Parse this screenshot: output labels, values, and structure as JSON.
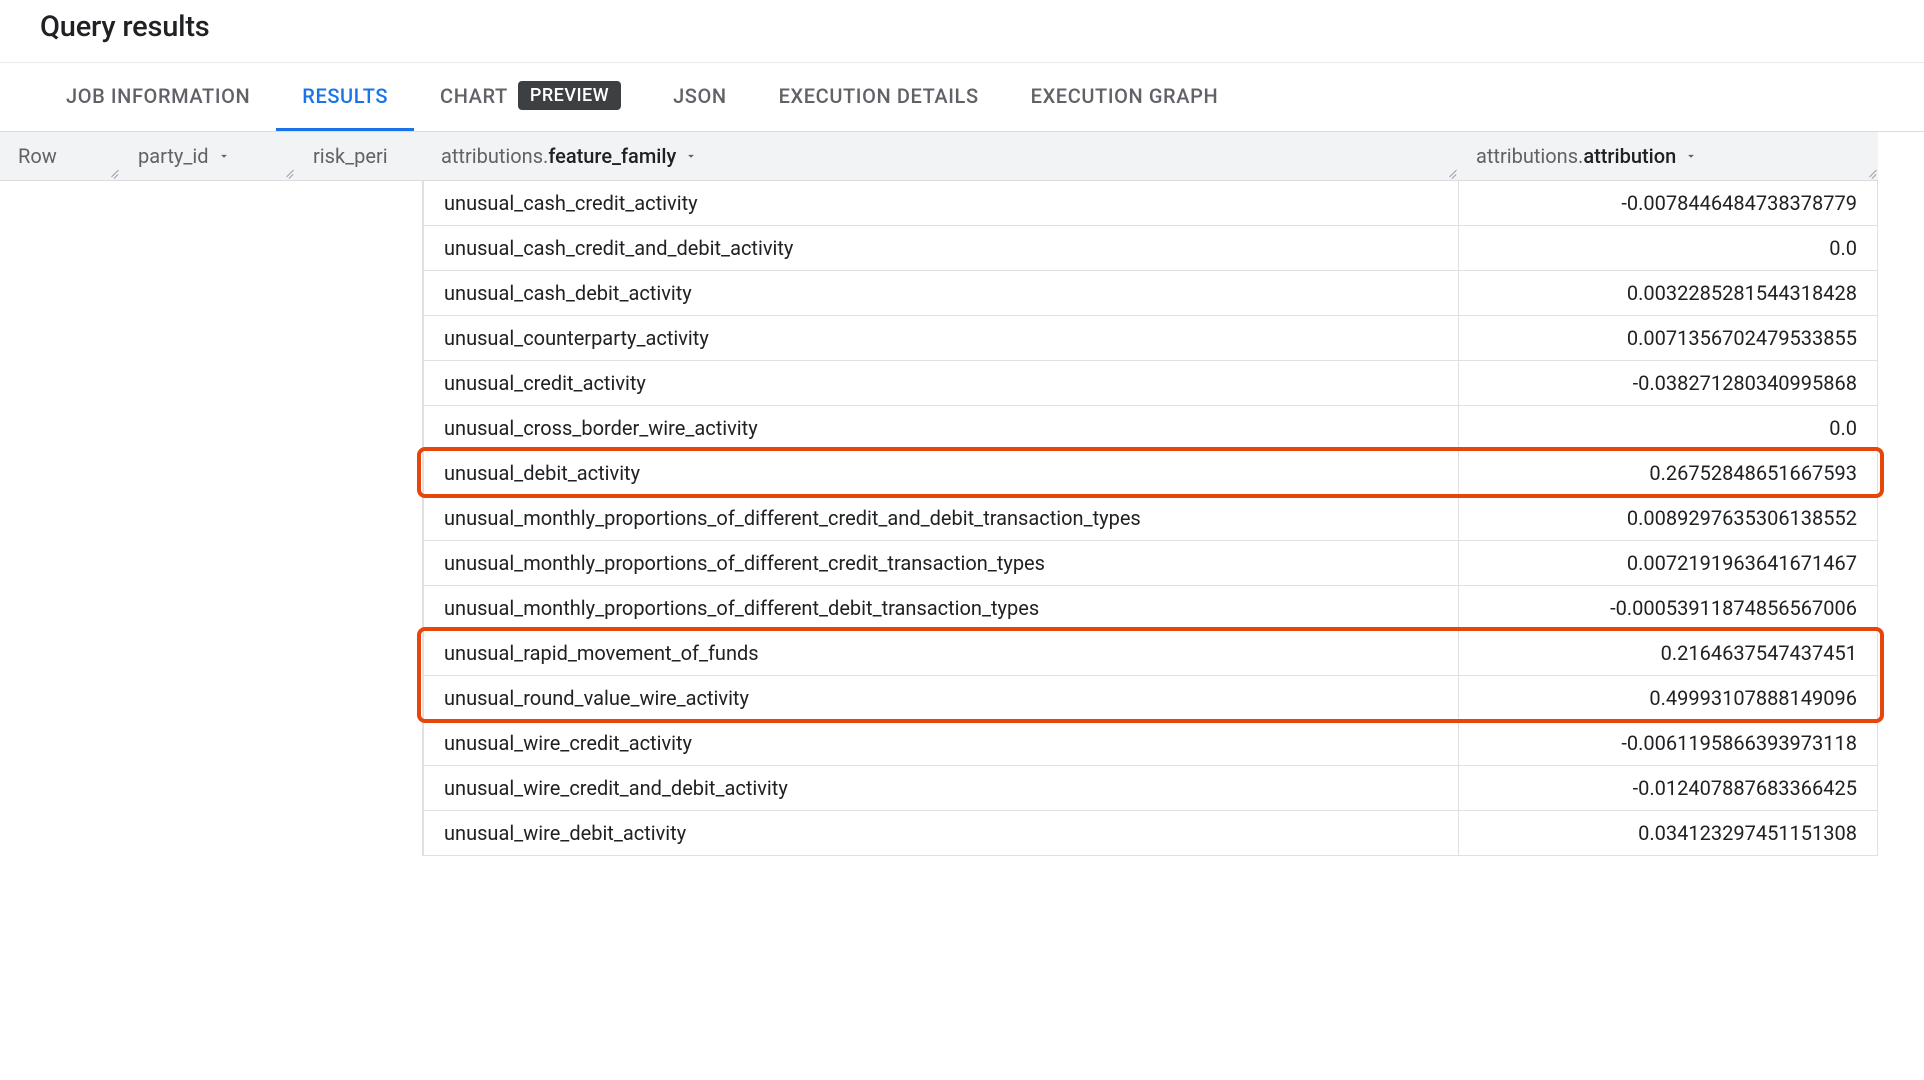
{
  "header": {
    "title": "Query results"
  },
  "tabs": {
    "job_info": "JOB INFORMATION",
    "results": "RESULTS",
    "chart": "CHART",
    "preview_badge": "PREVIEW",
    "json": "JSON",
    "exec_details": "EXECUTION DETAILS",
    "exec_graph": "EXECUTION GRAPH"
  },
  "columns": {
    "row": "Row",
    "party_id": "party_id",
    "risk_peri": "risk_peri",
    "feature_family_prefix": "attributions.",
    "feature_family_bold": "feature_family",
    "attribution_prefix": "attributions.",
    "attribution_bold": "attribution"
  },
  "rows": [
    {
      "feature_family": "unusual_cash_credit_activity",
      "attribution": "-0.0078446484738378779"
    },
    {
      "feature_family": "unusual_cash_credit_and_debit_activity",
      "attribution": "0.0"
    },
    {
      "feature_family": "unusual_cash_debit_activity",
      "attribution": "0.0032285281544318428"
    },
    {
      "feature_family": "unusual_counterparty_activity",
      "attribution": "0.0071356702479533855"
    },
    {
      "feature_family": "unusual_credit_activity",
      "attribution": "-0.038271280340995868"
    },
    {
      "feature_family": "unusual_cross_border_wire_activity",
      "attribution": "0.0"
    },
    {
      "feature_family": "unusual_debit_activity",
      "attribution": "0.26752848651667593",
      "hl": "a"
    },
    {
      "feature_family": "unusual_monthly_proportions_of_different_credit_and_debit_transaction_types",
      "attribution": "0.0089297635306138552"
    },
    {
      "feature_family": "unusual_monthly_proportions_of_different_credit_transaction_types",
      "attribution": "0.0072191963641671467"
    },
    {
      "feature_family": "unusual_monthly_proportions_of_different_debit_transaction_types",
      "attribution": "-0.00053911874856567006"
    },
    {
      "feature_family": "unusual_rapid_movement_of_funds",
      "attribution": "0.2164637547437451",
      "hl": "b"
    },
    {
      "feature_family": "unusual_round_value_wire_activity",
      "attribution": "0.49993107888149096",
      "hl": "b"
    },
    {
      "feature_family": "unusual_wire_credit_activity",
      "attribution": "-0.0061195866393973118"
    },
    {
      "feature_family": "unusual_wire_credit_and_debit_activity",
      "attribution": "-0.012407887683366425"
    },
    {
      "feature_family": "unusual_wire_debit_activity",
      "attribution": "0.034123297451151308"
    }
  ]
}
